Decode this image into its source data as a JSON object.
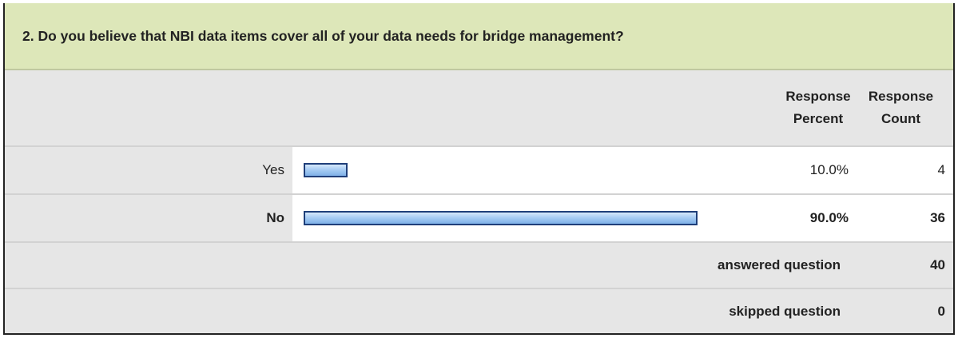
{
  "question": "2. Do you believe that NBI data items cover all of your data needs for bridge management?",
  "headers": {
    "percent_line1": "Response",
    "percent_line2": "Percent",
    "count_line1": "Response",
    "count_line2": "Count"
  },
  "rows": [
    {
      "label": "Yes",
      "percent_text": "10.0%",
      "count_text": "4",
      "bold": false
    },
    {
      "label": "No",
      "percent_text": "90.0%",
      "count_text": "36",
      "bold": true
    }
  ],
  "summary": [
    {
      "label": "answered question",
      "value": "40"
    },
    {
      "label": "skipped question",
      "value": "0"
    }
  ],
  "colors": {
    "question_bg": "#dde7b9",
    "bar_fill": "#a8cdf4",
    "bar_border": "#1f3f7a",
    "table_bg": "#e6e6e6"
  },
  "chart_data": {
    "type": "bar",
    "orientation": "horizontal",
    "categories": [
      "Yes",
      "No"
    ],
    "values": [
      10.0,
      90.0
    ],
    "counts": [
      4,
      36
    ],
    "xlim": [
      0,
      100
    ]
  }
}
